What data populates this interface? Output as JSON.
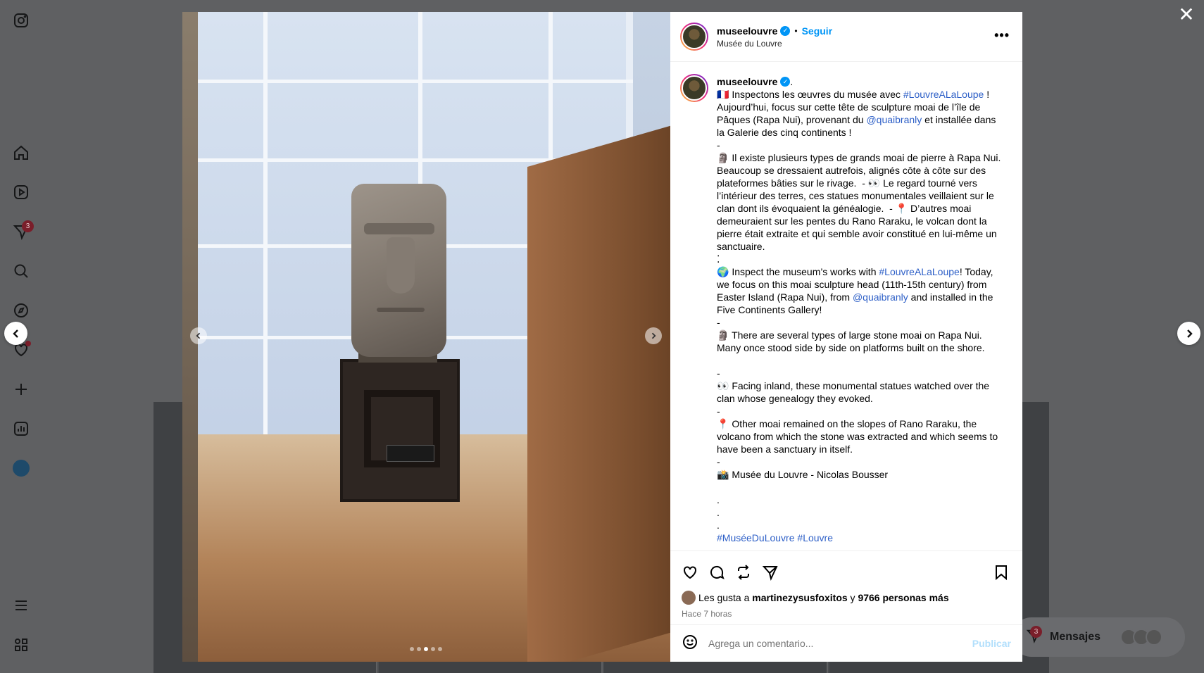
{
  "post": {
    "username": "museelouvre",
    "verified_mark": "✓",
    "follow_label": "Seguir",
    "location": "Musée du Louvre",
    "more_label": "•••",
    "caption_tail": " .",
    "caption": [
      [
        {
          "t": "🇫🇷 Inspectons les œuvres du musée avec "
        },
        {
          "t": "#LouvreALaLoupe",
          "k": "tag"
        },
        {
          "t": " ! Aujourd’hui, focus sur cette tête de sculpture moai de l’île de Pâques (Rapa Nui), provenant du "
        },
        {
          "t": "@quaibranly",
          "k": "mention"
        },
        {
          "t": " et installée dans la Galerie des cinq continents !"
        }
      ],
      [
        {
          "t": "-"
        }
      ],
      [
        {
          "t": "🗿 Il existe plusieurs types de grands moai de pierre à Rapa Nui. Beaucoup se dressaient autrefois, alignés côte à côte sur des plateformes bâties sur le rivage.  - 👀 Le regard tourné vers l’intérieur des terres, ces statues monumentales veillaient sur le clan dont ils évoquaient la généalogie.  - 📍 D’autres moai demeuraient sur les pentes du Rano Raraku, le volcan dont la pierre était extraite et qui semble avoir constitué en lui-même un sanctuaire."
        }
      ],
      [
        {
          "t": "⁚"
        }
      ],
      [
        {
          "t": "🌍 Inspect the museum’s works with "
        },
        {
          "t": "#LouvreALaLoupe",
          "k": "tag"
        },
        {
          "t": "! Today, we focus on this moai sculpture head (11th-15th century) from Easter Island (Rapa Nui), from "
        },
        {
          "t": "@quaibranly",
          "k": "mention"
        },
        {
          "t": " and installed in the Five Continents Gallery!"
        }
      ],
      [
        {
          "t": "-"
        }
      ],
      [
        {
          "t": "🗿 There are several types of large stone moai on Rapa Nui. Many once stood side by side on platforms built on the shore."
        }
      ],
      [
        {
          "t": " "
        }
      ],
      [
        {
          "t": "-"
        }
      ],
      [
        {
          "t": "👀 Facing inland, these monumental statues watched over the clan whose genealogy they evoked."
        }
      ],
      [
        {
          "t": "-"
        }
      ],
      [
        {
          "t": "📍 Other moai remained on the slopes of Rano Raraku, the volcano from which the stone was extracted and which seems to have been a sanctuary in itself."
        }
      ],
      [
        {
          "t": "-"
        }
      ],
      [
        {
          "t": "📸 Musée du Louvre - Nicolas Bousser"
        }
      ],
      [
        {
          "t": " "
        }
      ],
      [
        {
          "t": "."
        }
      ],
      [
        {
          "t": "."
        }
      ],
      [
        {
          "t": "."
        }
      ],
      [
        {
          "t": "#MuséeDuLouvre",
          "k": "tag"
        },
        {
          "t": " "
        },
        {
          "t": "#Louvre",
          "k": "tag"
        }
      ]
    ],
    "likes_prefix": "Les gusta a ",
    "likes_user": "martinezysusfoxitos",
    "likes_mid": " y ",
    "likes_count": "9766 personas más",
    "time": "Hace 7 horas",
    "comment_placeholder": "Agrega un comentario...",
    "publish_label": "Publicar",
    "carousel_index": 3,
    "carousel_total": 5
  },
  "ui": {
    "close_label": "✕",
    "messages_label": "Mensajes",
    "notification_count": "3",
    "messages_count": "3"
  }
}
